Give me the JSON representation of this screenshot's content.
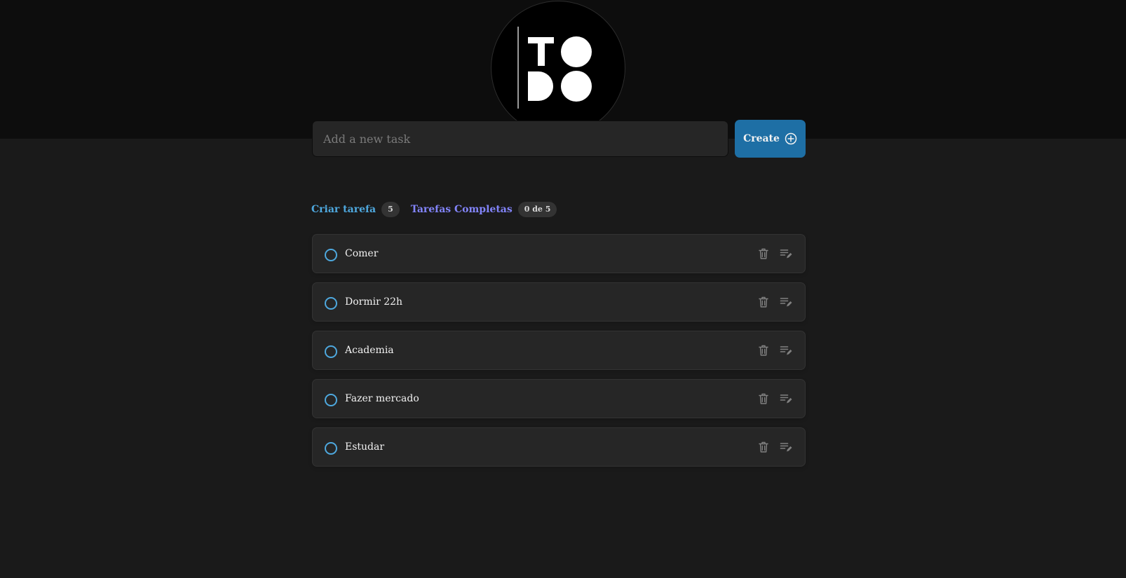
{
  "logo": {
    "letters": "TODO"
  },
  "new_task": {
    "placeholder": "Add a new task",
    "value": ""
  },
  "create_button": {
    "label": "Create",
    "icon": "plus-circle-icon"
  },
  "counters": {
    "created_label": "Criar tarefa",
    "created_count": "5",
    "completed_label": "Tarefas Completas",
    "completed_count": "0 de 5"
  },
  "tasks": [
    {
      "text": "Comer",
      "done": false
    },
    {
      "text": "Dormir 22h",
      "done": false
    },
    {
      "text": "Academia",
      "done": false
    },
    {
      "text": "Fazer mercado",
      "done": false
    },
    {
      "text": "Estudar",
      "done": false
    }
  ],
  "icons": {
    "delete": "trash-icon",
    "edit": "edit-list-icon",
    "checkbox": "circle-checkbox-icon"
  },
  "colors": {
    "background": "#1a1a1a",
    "header": "#0d0d0d",
    "card": "#262626",
    "primary_blue": "#4ea8de",
    "button_blue": "#1e6fa5",
    "purple": "#8284fa",
    "text": "#f2f2f2",
    "muted_icon": "#808080"
  }
}
